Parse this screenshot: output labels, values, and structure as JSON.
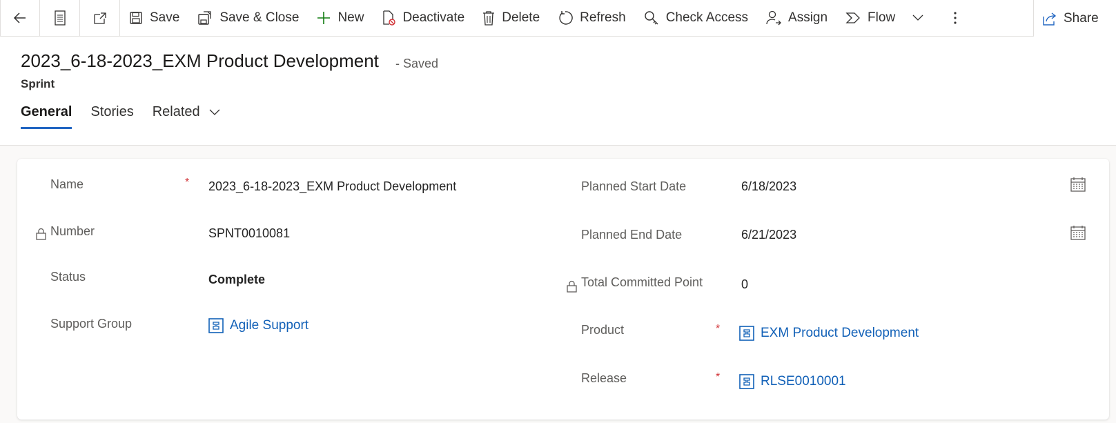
{
  "commandbar": {
    "save": "Save",
    "save_close": "Save & Close",
    "new": "New",
    "deactivate": "Deactivate",
    "delete": "Delete",
    "refresh": "Refresh",
    "check_access": "Check Access",
    "assign": "Assign",
    "flow": "Flow",
    "share": "Share"
  },
  "header": {
    "title": "2023_6-18-2023_EXM Product Development",
    "saved_status": "- Saved",
    "entity": "Sprint"
  },
  "tabs": [
    "General",
    "Stories",
    "Related"
  ],
  "form": {
    "left": {
      "name_label": "Name",
      "name_value": "2023_6-18-2023_EXM Product Development",
      "number_label": "Number",
      "number_value": "SPNT0010081",
      "status_label": "Status",
      "status_value": "Complete",
      "support_group_label": "Support Group",
      "support_group_value": "Agile Support"
    },
    "right": {
      "start_label": "Planned Start Date",
      "start_value": "6/18/2023",
      "end_label": "Planned End Date",
      "end_value": "6/21/2023",
      "points_label": "Total Committed Point",
      "points_value": "0",
      "product_label": "Product",
      "product_value": "EXM Product Development",
      "release_label": "Release",
      "release_value": "RLSE0010001"
    },
    "required_mark": "*"
  },
  "colors": {
    "accent": "#2266c2",
    "link": "#1160b7",
    "required": "#d13438"
  }
}
